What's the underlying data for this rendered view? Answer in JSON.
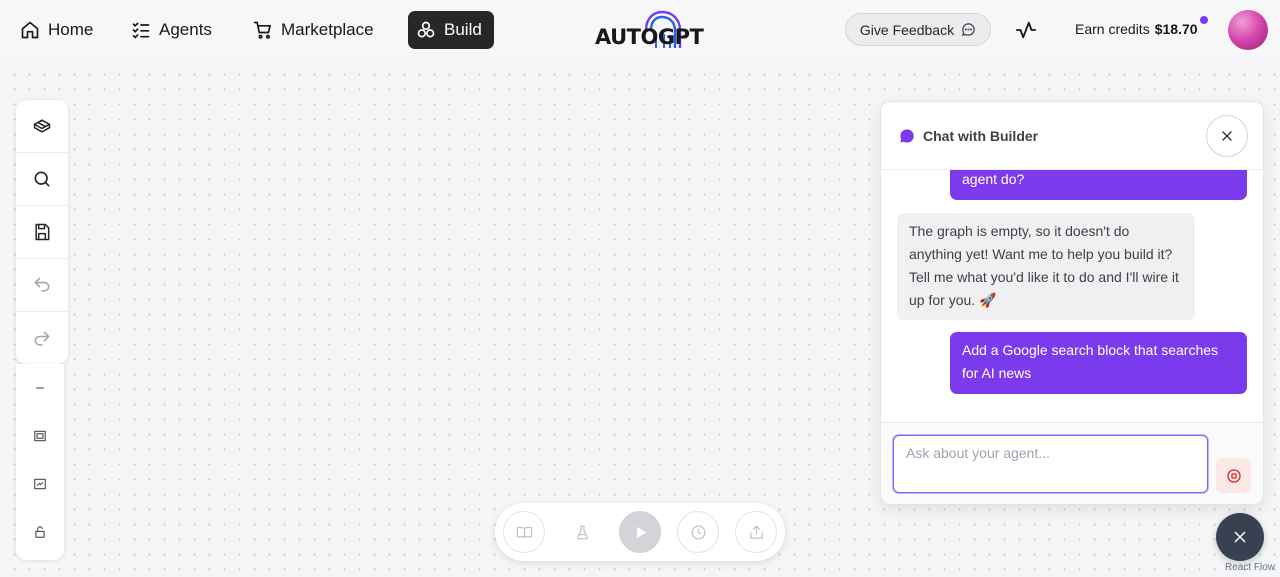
{
  "nav": {
    "home": "Home",
    "agents": "Agents",
    "marketplace": "Marketplace",
    "build": "Build"
  },
  "logo": {
    "text": "AUTOGPT"
  },
  "header": {
    "feedback_label": "Give Feedback",
    "credits_label": "Earn credits",
    "credits_amount": "$18.70"
  },
  "toolbar": {
    "icons": [
      "blocks-icon",
      "search-icon",
      "save-icon",
      "undo-icon",
      "redo-icon"
    ]
  },
  "flow_controls": {
    "icons": [
      "zoom-out-icon",
      "fit-view-icon",
      "frame-icon",
      "lock-icon"
    ]
  },
  "run_bar": {
    "icons": [
      "guide-icon",
      "test-flask-icon",
      "play-icon",
      "schedule-icon",
      "share-icon"
    ]
  },
  "chat": {
    "title": "Chat with Builder",
    "messages": [
      {
        "role": "user",
        "text": "agent do?"
      },
      {
        "role": "assistant",
        "text": "The graph is empty, so it doesn't do anything yet! Want me to help you build it? Tell me what you'd like it to do and I'll wire it up for you. 🚀"
      },
      {
        "role": "user",
        "text": "Add a Google search block that searches for AI news"
      }
    ],
    "input_placeholder": "Ask about your agent..."
  },
  "attribution": "React Flow",
  "colors": {
    "accent": "#7c3aed",
    "active_nav": "#27272a",
    "fab": "#374151"
  }
}
